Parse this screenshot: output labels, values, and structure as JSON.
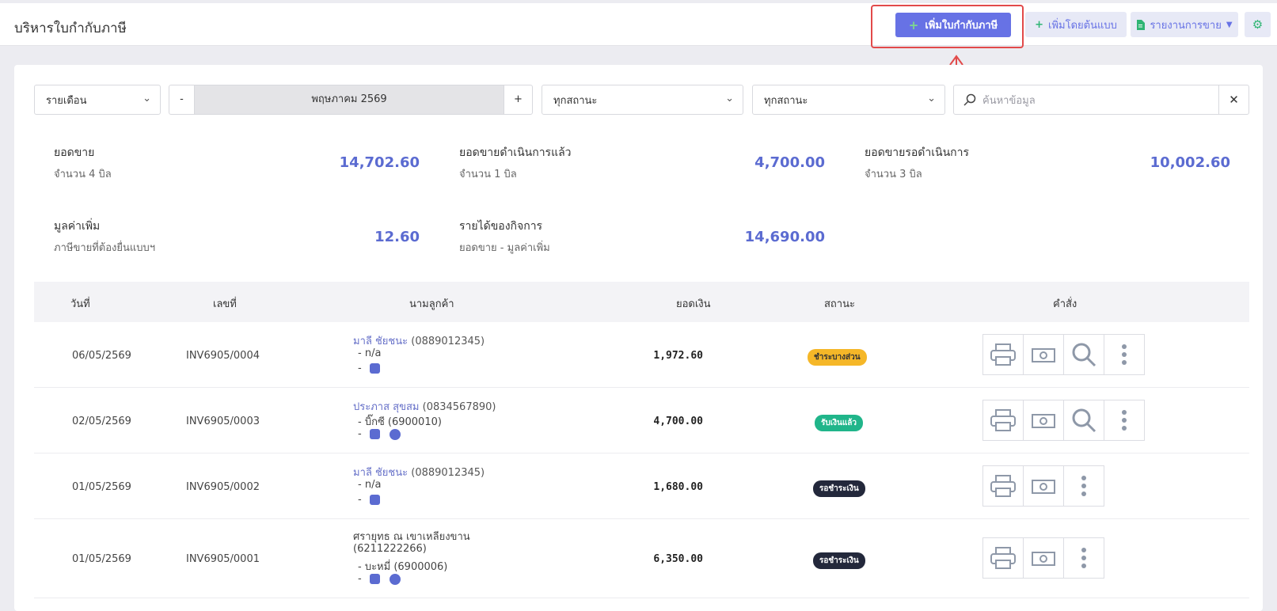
{
  "header": {
    "title": "บริหารใบกำกับภาษี",
    "add_invoice": "เพิ่มใบกำกับภาษี",
    "add_from_template": "เพิ่มโดยต้นแบบ",
    "sales_report": "รายงานการขาย"
  },
  "filters": {
    "period_type": "รายเดือน",
    "minus": "-",
    "period": "พฤษภาคม 2569",
    "plus": "+",
    "status1": "ทุกสถานะ",
    "status2": "ทุกสถานะ",
    "search_placeholder": "ค้นหาข้อมูล"
  },
  "stats": {
    "sales": {
      "label": "ยอดขาย",
      "sub": "จำนวน 4 บิล",
      "value": "14,702.60"
    },
    "processed": {
      "label": "ยอดขายดำเนินการแล้ว",
      "sub": "จำนวน 1 บิล",
      "value": "4,700.00"
    },
    "pending": {
      "label": "ยอดขายรอดำเนินการ",
      "sub": "จำนวน 3 บิล",
      "value": "10,002.60"
    },
    "vat": {
      "label": "มูลค่าเพิ่ม",
      "sub": "ภาษีขายที่ต้องยื่นแบบฯ",
      "value": "12.60"
    },
    "income": {
      "label": "รายได้ของกิจการ",
      "sub": "ยอดขาย - มูลค่าเพิ่ม",
      "value": "14,690.00"
    }
  },
  "table": {
    "headers": {
      "date": "วันที่",
      "number": "เลขที่",
      "customer": "นามลูกค้า",
      "amount": "ยอดเงิน",
      "status": "สถานะ",
      "actions": "คำสั่ง"
    },
    "rows": [
      {
        "date": "06/05/2569",
        "number": "INV6905/0004",
        "name": "มาลี ชัยชนะ",
        "phone": "(0889012345)",
        "line2": "-   n/a",
        "line3": "-",
        "amount": "1,972.60",
        "status": "ชำระบางส่วน"
      },
      {
        "date": "02/05/2569",
        "number": "INV6905/0003",
        "name": "ประภาส สุขสม",
        "phone": "(0834567890)",
        "line2": "-   บิ๊กซี (6900010)",
        "line3": "-",
        "amount": "4,700.00",
        "status": "รับเงินแล้ว"
      },
      {
        "date": "01/05/2569",
        "number": "INV6905/0002",
        "name": "มาลี ชัยชนะ",
        "phone": "(0889012345)",
        "line2": "-   n/a",
        "line3": "-",
        "amount": "1,680.00",
        "status": "รอชำระเงิน"
      },
      {
        "date": "01/05/2569",
        "number": "INV6905/0001",
        "name": "ศรายุทธ ณ เขาเหลียงขาน",
        "phone": "(6211222266)",
        "line2": "-   บะหมี่ (6900006)",
        "line3": "-",
        "amount": "6,350.00",
        "status": "รอชำระเงิน"
      }
    ]
  },
  "colors": {
    "accent": "#6772e5",
    "value": "#5b6bd1",
    "highlight": "#e24a4a"
  }
}
